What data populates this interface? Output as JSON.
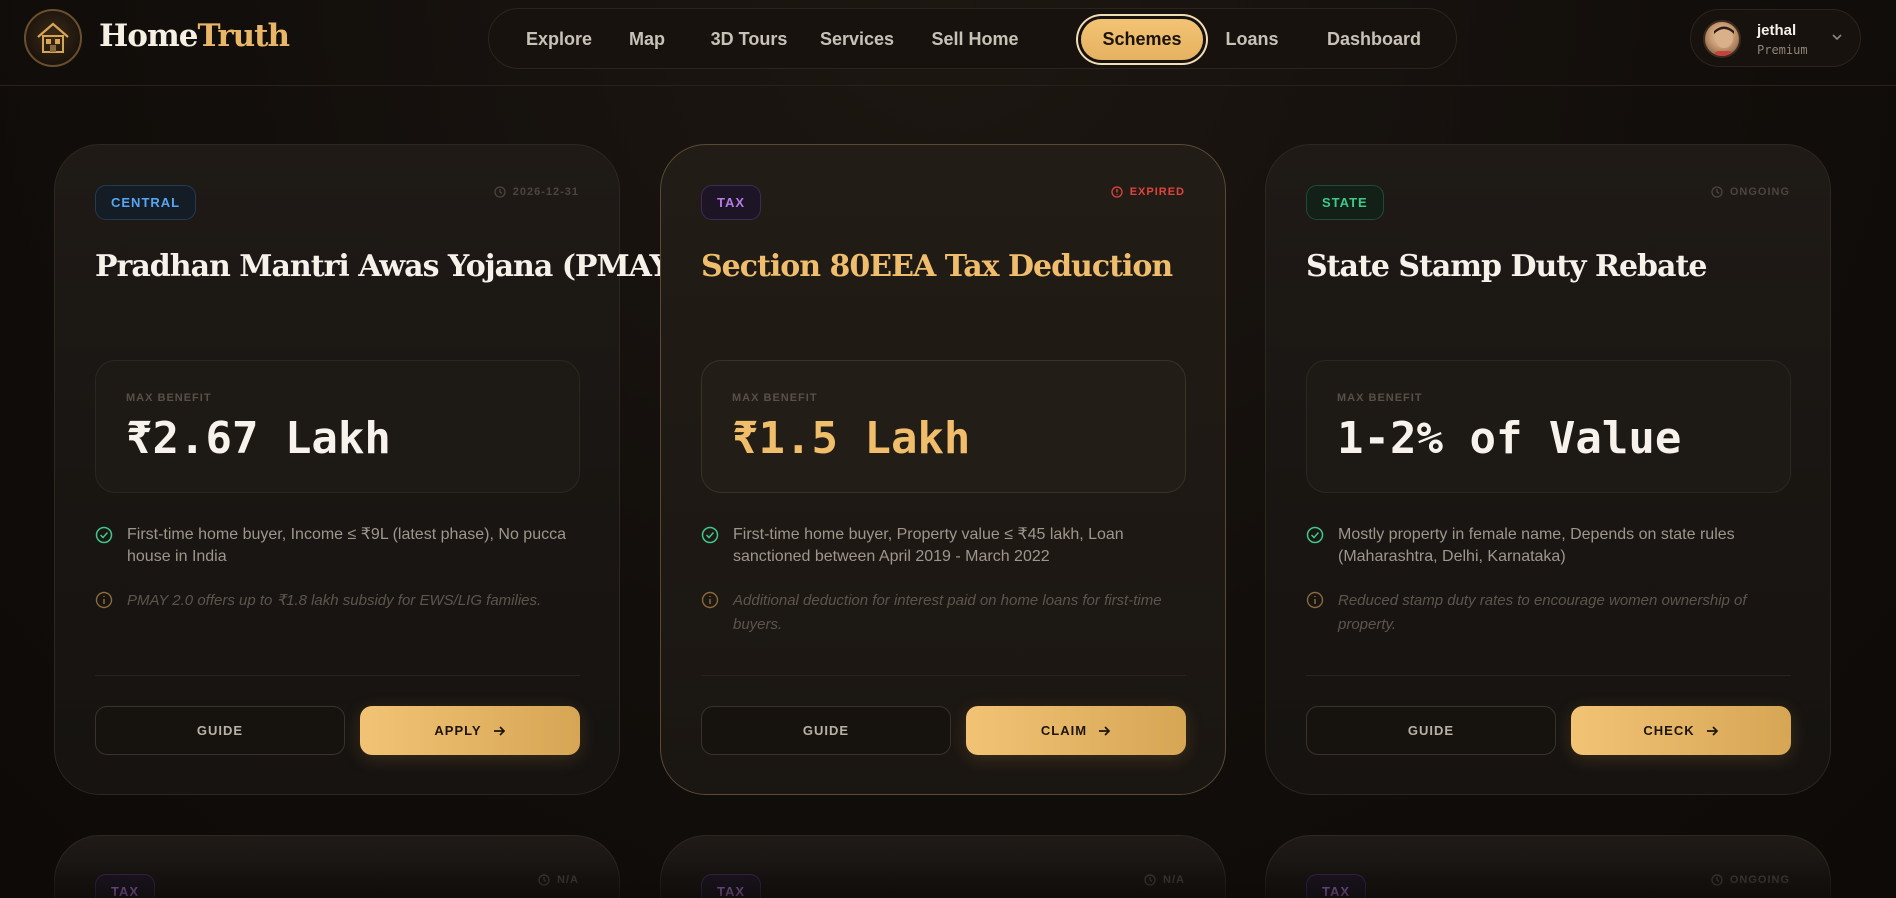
{
  "brand": {
    "part1": "Home",
    "part2": "Truth"
  },
  "nav": {
    "items": [
      {
        "label": "Explore"
      },
      {
        "label": "Map"
      },
      {
        "label": "3D Tours"
      },
      {
        "label": "Services"
      },
      {
        "label": "Sell Home"
      },
      {
        "label": "Schemes",
        "active": true
      },
      {
        "label": "Loans"
      },
      {
        "label": "Dashboard"
      }
    ]
  },
  "user": {
    "name": "jethal",
    "tier": "Premium"
  },
  "colors": {
    "accent": "#f2c375",
    "central": "#58a6f0",
    "tax": "#b77be6",
    "state": "#3fc888",
    "expired": "#e0453d"
  },
  "schemes": [
    {
      "category": "CENTRAL",
      "status": "2026-12-31",
      "status_icon": "clock-icon",
      "title": "Pradhan Mantri Awas Yojana (PMAY)",
      "benefit_label": "MAX BENEFIT",
      "benefit_value": "₹2.67 Lakh",
      "eligibility": "First-time home buyer, Income ≤ ₹9L (latest phase), No pucca house in India",
      "note": "PMAY 2.0 offers up to ₹1.8 lakh subsidy for EWS/LIG families.",
      "guide_label": "GUIDE",
      "action_label": "APPLY"
    },
    {
      "category": "TAX",
      "status": "EXPIRED",
      "status_icon": "alert-icon",
      "title": "Section 80EEA Tax Deduction",
      "benefit_label": "MAX BENEFIT",
      "benefit_value": "₹1.5 Lakh",
      "eligibility": "First-time home buyer, Property value ≤ ₹45 lakh, Loan sanctioned between April 2019 - March 2022",
      "note": "Additional deduction for interest paid on home loans for first-time buyers.",
      "guide_label": "GUIDE",
      "action_label": "CLAIM"
    },
    {
      "category": "STATE",
      "status": "ONGOING",
      "status_icon": "clock-icon",
      "title": "State Stamp Duty Rebate",
      "benefit_label": "MAX BENEFIT",
      "benefit_value": "1-2% of Value",
      "eligibility": "Mostly property in female name, Depends on state rules (Maharashtra, Delhi, Karnataka)",
      "note": "Reduced stamp duty rates to encourage women ownership of property.",
      "guide_label": "GUIDE",
      "action_label": "CHECK"
    },
    {
      "category": "TAX",
      "status": "N/A"
    },
    {
      "category": "TAX",
      "status": "N/A"
    },
    {
      "category": "TAX",
      "status": "ONGOING"
    }
  ]
}
